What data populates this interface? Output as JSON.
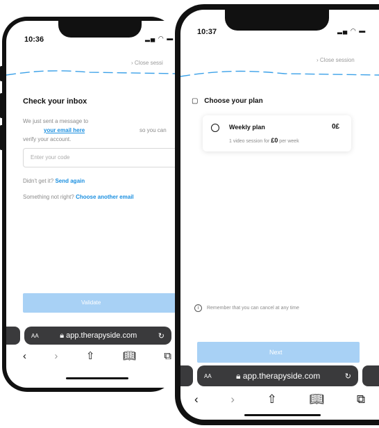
{
  "left_phone": {
    "time": "10:36",
    "close_session": "Close sessi",
    "heading": "Check your inbox",
    "message_line1": "We just sent a message to",
    "email": "your email here",
    "message_tail": "so you can",
    "message_line2": "verify your account.",
    "code_placeholder": "Enter your code",
    "didnt_get": "Didn't get it?",
    "send_again": "Send again",
    "something_wrong": "Something not right?",
    "choose_email": "Choose another email",
    "validate_label": "Validate",
    "url": "app.therapyside.com",
    "aa": "AA"
  },
  "right_phone": {
    "time": "10:37",
    "close_session": "Close session",
    "choose_plan": "Choose your plan",
    "plan_name": "Weekly plan",
    "plan_price": "0£",
    "plan_desc_prefix": "1 video session for",
    "plan_desc_amount": "£0",
    "plan_desc_suffix": "per week",
    "reminder": "Remember that you can cancel at any time",
    "next_label": "Next",
    "url": "app.therapyside.com",
    "aa": "AA"
  },
  "colors": {
    "accent_blue": "#1a8fe0",
    "button_disabled": "#a8d1f5",
    "wave": "#3aa0e8"
  },
  "icons": {
    "signal": "signal-icon",
    "wifi": "wifi-icon",
    "battery": "battery-icon",
    "lock": "lock-icon",
    "reload": "reload-icon",
    "back": "chevron-left-icon",
    "forward": "chevron-right-icon",
    "share": "share-icon",
    "bookmarks": "book-icon",
    "tabs": "tabs-icon",
    "calendar": "calendar-icon",
    "info": "info-icon",
    "radio": "radio-icon"
  }
}
